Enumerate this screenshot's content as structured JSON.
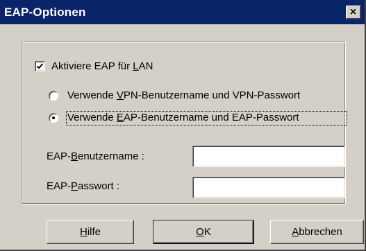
{
  "dialog": {
    "title": "EAP-Optionen",
    "close_label": "×"
  },
  "options": {
    "enable_eap": {
      "label_pre": "Aktiviere EAP für ",
      "label_u": "L",
      "label_post": "AN",
      "checked": true
    },
    "radio_vpn": {
      "label_pre": "Verwende ",
      "label_u": "V",
      "label_post": "PN-Benutzername und VPN-Passwort",
      "selected": false
    },
    "radio_eap": {
      "label_pre": "Verwende ",
      "label_u": "E",
      "label_post": "AP-Benutzername und EAP-Passwort",
      "selected": true
    }
  },
  "fields": {
    "username": {
      "label_pre": "EAP-",
      "label_u": "B",
      "label_post": "enutzername :",
      "value": ""
    },
    "password": {
      "label_pre": "EAP-",
      "label_u": "P",
      "label_post": "asswort :",
      "value": ""
    }
  },
  "buttons": {
    "help": {
      "u": "H",
      "rest": "ilfe"
    },
    "ok": {
      "u": "O",
      "rest": "K"
    },
    "cancel": {
      "u": "A",
      "rest": "bbrechen"
    }
  }
}
